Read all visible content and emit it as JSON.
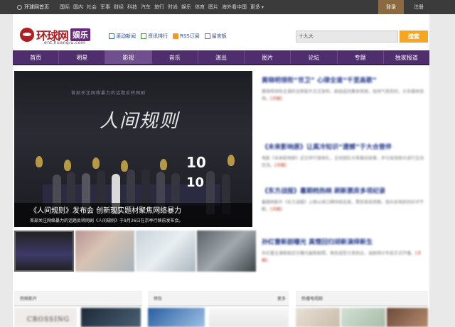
{
  "topbar": {
    "home_label": "环球网首页",
    "links": [
      "国际",
      "国内",
      "社会",
      "军事",
      "财经",
      "科技",
      "汽车",
      "旅行",
      "时尚",
      "娱乐",
      "体育",
      "图片",
      "海外看中国",
      "更多"
    ],
    "login_label": "登录",
    "register_label": "注册"
  },
  "header": {
    "logo_name": "环球网",
    "logo_sub": "娱乐",
    "logo_url": "ent.huanqiu.com",
    "links": [
      {
        "icon": "news-icon",
        "label": "滚动新闻"
      },
      {
        "icon": "rank-icon",
        "label": "资讯排行"
      },
      {
        "icon": "rss-icon",
        "label": "RSS订阅"
      },
      {
        "icon": "message-icon",
        "label": "留言板"
      }
    ],
    "search_value": "十九大",
    "search_button": "搜索"
  },
  "nav": {
    "items": [
      "首页",
      "明星",
      "影视",
      "音乐",
      "演出",
      "图片",
      "论坛",
      "专题",
      "独家报道"
    ],
    "active": "影视"
  },
  "hero": {
    "top_line": "首部关注网络暴力的话题反转网剧",
    "big_title": "人间规则",
    "screen_num_1": "10",
    "screen_num_2": "10",
    "caption_title": "《人间规则》发布会 创新现实题材聚焦网络暴力",
    "caption_sub": "首部关注网络暴力的话题反转网剧《人间规则》于9月26日在京举行映前发布会。"
  },
  "news": [
    {
      "headline": "黄晓明领衔“世卫”  心律全速“千里高歌”",
      "body": "黄晓明领衔主演的全新影片正式发布，剧组成员集体亮相，现场气氛热烈，众多媒体到场。",
      "more": "[详细]"
    },
    {
      "headline": "《未来影响原》让真冷知识“遗憾”于大合营伴",
      "body": "电影《未来影响原》近日举行首映礼，主创团队分享幕后故事，并与现场观众进行互动交流。",
      "more": "[详细]"
    },
    {
      "headline": "《东方战报》暑期档热映 刷新票房多项纪录",
      "body": "暑期档影片《东方战报》上映以来口碑持续走高，票房表现亮眼，观众反响热烈好评不断。",
      "more": "[详细]"
    },
    {
      "headline": "孙红雷新剧曝光  真情回归胡新演绎新生",
      "body": "孙红雷主演新剧近日曝光最新剧照，角色造型引发热议，该剧预计年底正式开播。",
      "more": "[详细]"
    }
  ],
  "bottom": {
    "bar1_title": "热映影片",
    "bar2_title": "预告",
    "bar2_more": "更多",
    "bar3_title": "热播电视剧",
    "film_label": "CROSSING"
  }
}
